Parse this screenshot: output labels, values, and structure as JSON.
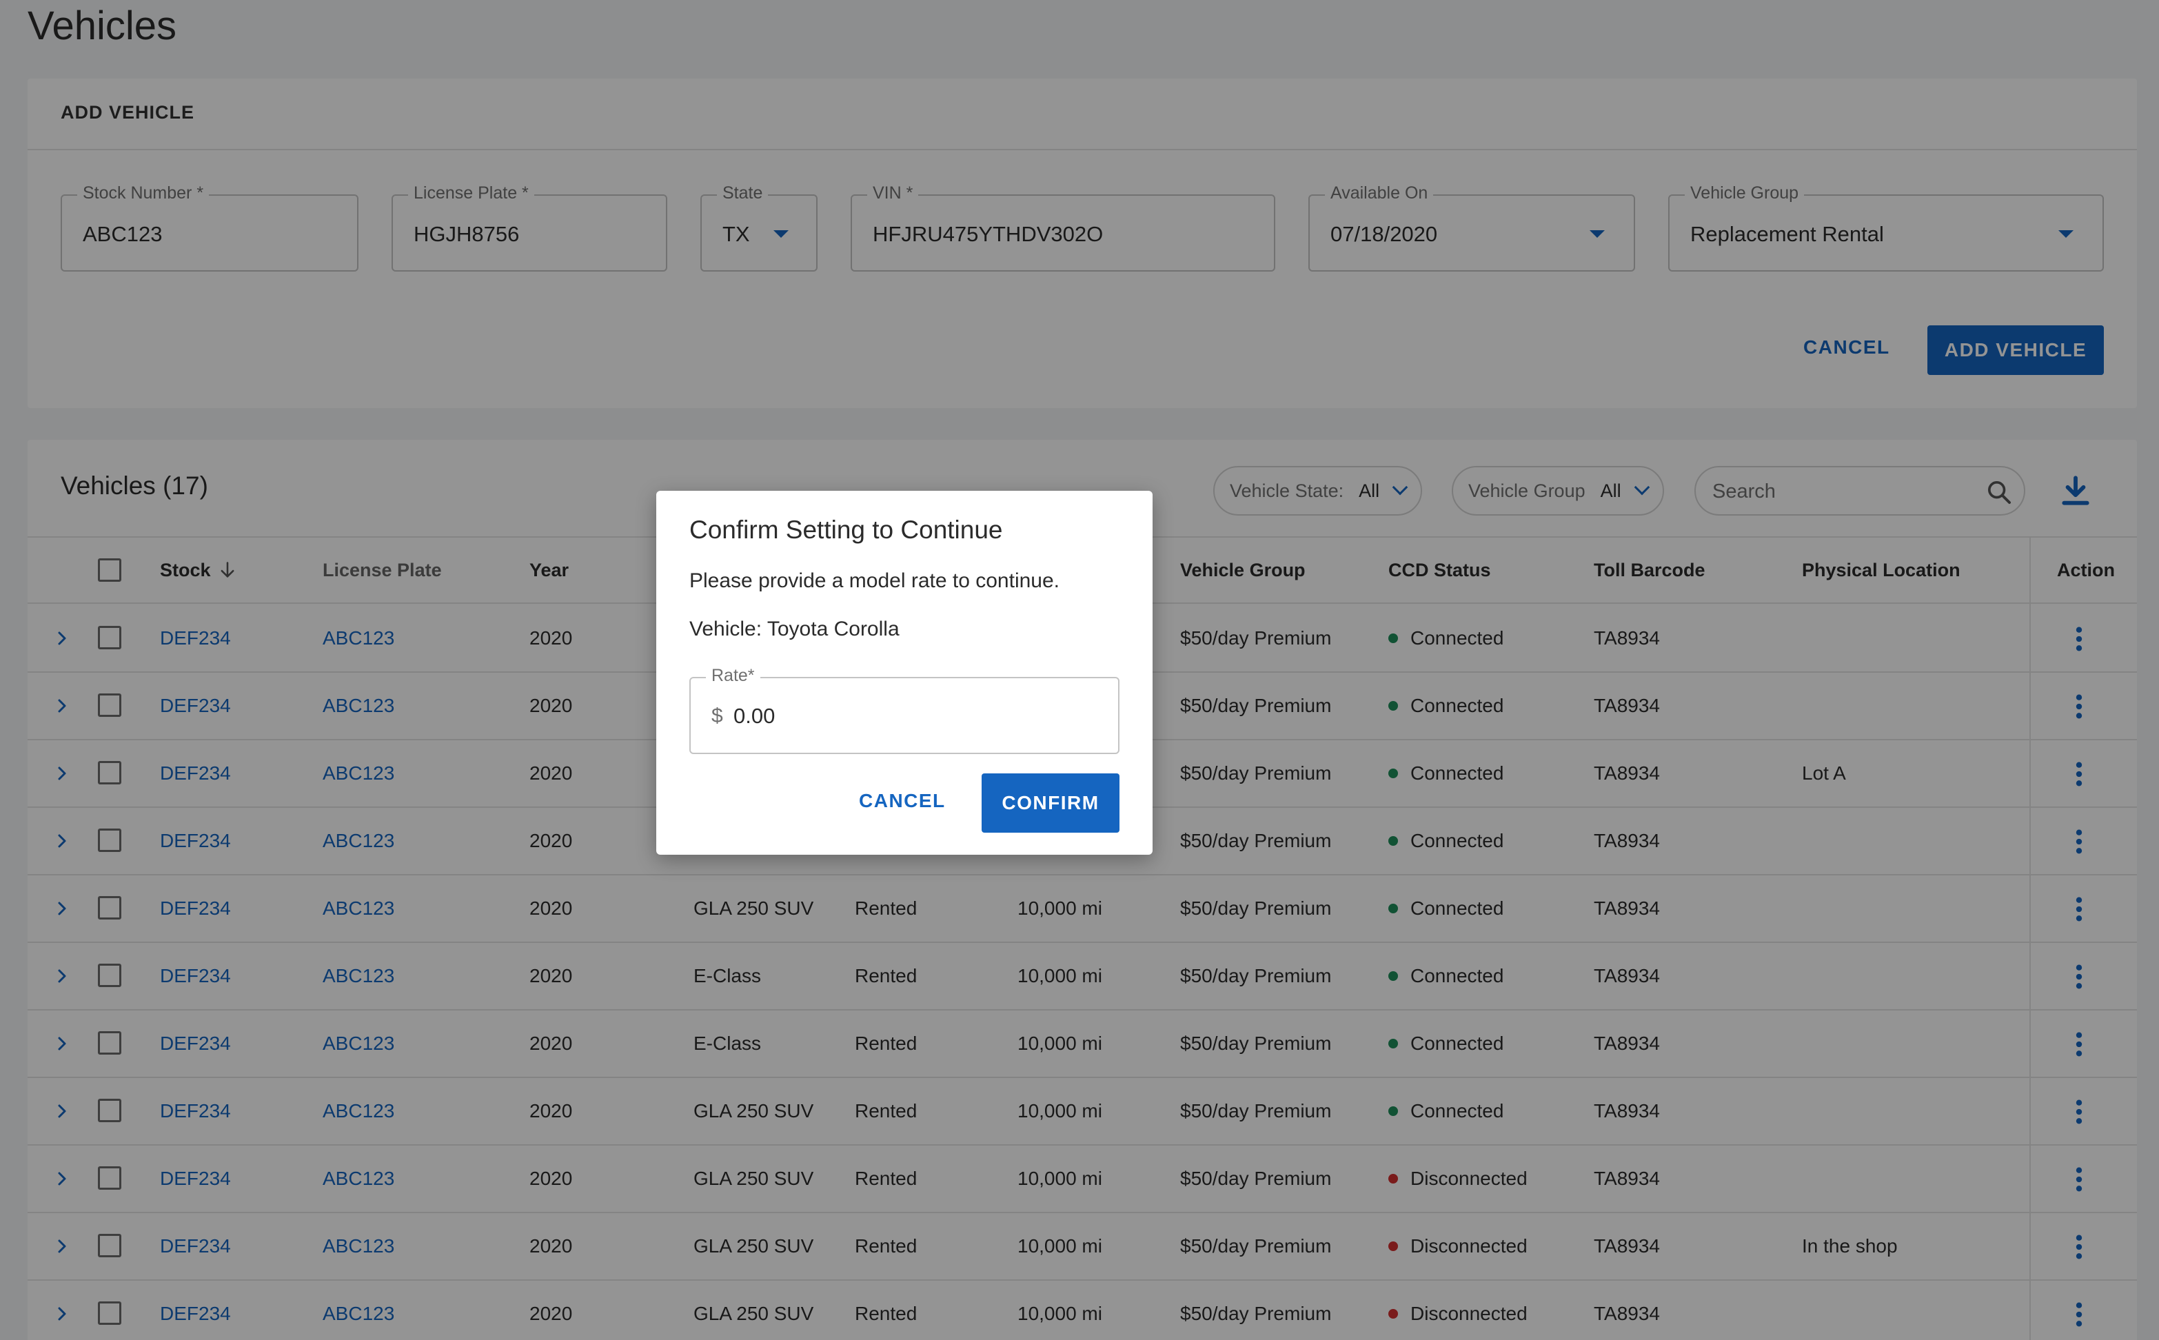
{
  "page": {
    "title": "Vehicles"
  },
  "add_vehicle": {
    "heading": "ADD VEHICLE",
    "fields": {
      "stock_number": {
        "label": "Stock Number *",
        "value": "ABC123"
      },
      "license_plate": {
        "label": "License Plate *",
        "value": "HGJH8756"
      },
      "state": {
        "label": "State",
        "value": "TX"
      },
      "vin": {
        "label": "VIN *",
        "value": "HFJRU475YTHDV302O"
      },
      "available_on": {
        "label": "Available On",
        "value": "07/18/2020"
      },
      "vehicle_group": {
        "label": "Vehicle Group",
        "value": "Replacement Rental"
      }
    },
    "cancel_label": "CANCEL",
    "add_label": "ADD VEHICLE"
  },
  "vehicles_table": {
    "title": "Vehicles (17)",
    "filters": {
      "vehicle_state": {
        "label": "Vehicle State:",
        "value": "All"
      },
      "vehicle_group": {
        "label": "Vehicle Group",
        "value": "All"
      }
    },
    "search_placeholder": "Search",
    "columns": {
      "stock": "Stock",
      "license_plate": "License Plate",
      "year": "Year",
      "vehicle_group": "Vehicle Group",
      "ccd_status": "CCD Status",
      "toll_barcode": "Toll Barcode",
      "physical_location": "Physical Location",
      "action": "Action"
    },
    "rows": [
      {
        "stock": "DEF234",
        "plate": "ABC123",
        "year": "2020",
        "model": "",
        "state": "",
        "mileage": "",
        "group": "$50/day Premium",
        "ccd": "Connected",
        "toll": "TA8934",
        "location": ""
      },
      {
        "stock": "DEF234",
        "plate": "ABC123",
        "year": "2020",
        "model": "",
        "state": "",
        "mileage": "",
        "group": "$50/day Premium",
        "ccd": "Connected",
        "toll": "TA8934",
        "location": ""
      },
      {
        "stock": "DEF234",
        "plate": "ABC123",
        "year": "2020",
        "model": "",
        "state": "",
        "mileage": "",
        "group": "$50/day Premium",
        "ccd": "Connected",
        "toll": "TA8934",
        "location": "Lot A"
      },
      {
        "stock": "DEF234",
        "plate": "ABC123",
        "year": "2020",
        "model": "",
        "state": "",
        "mileage": "",
        "group": "$50/day Premium",
        "ccd": "Connected",
        "toll": "TA8934",
        "location": ""
      },
      {
        "stock": "DEF234",
        "plate": "ABC123",
        "year": "2020",
        "model": "GLA 250 SUV",
        "state": "Rented",
        "mileage": "10,000 mi",
        "group": "$50/day Premium",
        "ccd": "Connected",
        "toll": "TA8934",
        "location": ""
      },
      {
        "stock": "DEF234",
        "plate": "ABC123",
        "year": "2020",
        "model": "E-Class",
        "state": "Rented",
        "mileage": "10,000 mi",
        "group": "$50/day Premium",
        "ccd": "Connected",
        "toll": "TA8934",
        "location": ""
      },
      {
        "stock": "DEF234",
        "plate": "ABC123",
        "year": "2020",
        "model": "E-Class",
        "state": "Rented",
        "mileage": "10,000 mi",
        "group": "$50/day Premium",
        "ccd": "Connected",
        "toll": "TA8934",
        "location": ""
      },
      {
        "stock": "DEF234",
        "plate": "ABC123",
        "year": "2020",
        "model": "GLA 250 SUV",
        "state": "Rented",
        "mileage": "10,000 mi",
        "group": "$50/day Premium",
        "ccd": "Connected",
        "toll": "TA8934",
        "location": ""
      },
      {
        "stock": "DEF234",
        "plate": "ABC123",
        "year": "2020",
        "model": "GLA 250 SUV",
        "state": "Rented",
        "mileage": "10,000 mi",
        "group": "$50/day Premium",
        "ccd": "Disconnected",
        "toll": "TA8934",
        "location": ""
      },
      {
        "stock": "DEF234",
        "plate": "ABC123",
        "year": "2020",
        "model": "GLA 250 SUV",
        "state": "Rented",
        "mileage": "10,000 mi",
        "group": "$50/day Premium",
        "ccd": "Disconnected",
        "toll": "TA8934",
        "location": "In the shop"
      },
      {
        "stock": "DEF234",
        "plate": "ABC123",
        "year": "2020",
        "model": "GLA 250 SUV",
        "state": "Rented",
        "mileage": "10,000 mi",
        "group": "$50/day Premium",
        "ccd": "Disconnected",
        "toll": "TA8934",
        "location": ""
      }
    ]
  },
  "status_colors": {
    "Connected": "#1e8e5a",
    "Disconnected": "#d32f2f"
  },
  "accent_color": "#1565c0",
  "icons": {
    "sort": "arrow-down-icon",
    "expand": "chevron-right-icon",
    "row_action": "more-vertical-icon",
    "search": "search-icon",
    "download": "download-icon"
  },
  "modal": {
    "title": "Confirm Setting to Continue",
    "message": "Please provide a model rate to continue.",
    "vehicle_line": "Vehicle: Toyota Corolla",
    "rate": {
      "label": "Rate*",
      "prefix": "$",
      "value": "0.00"
    },
    "cancel_label": "CANCEL",
    "confirm_label": "CONFIRM"
  }
}
